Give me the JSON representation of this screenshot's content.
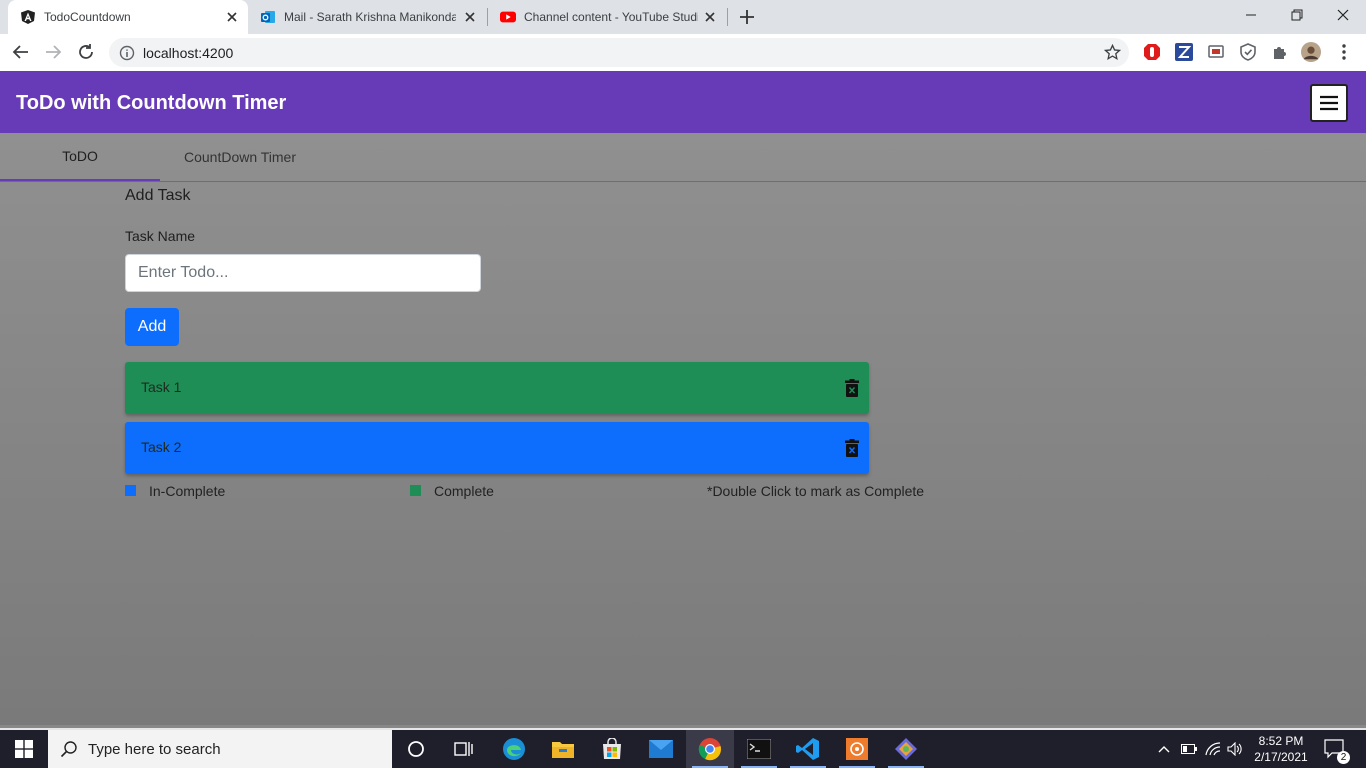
{
  "browser": {
    "tabs": [
      {
        "title": "TodoCountdown",
        "icon": "angular-icon",
        "active": true
      },
      {
        "title": "Mail - Sarath Krishna Manikonda",
        "icon": "outlook-icon",
        "active": false
      },
      {
        "title": "Channel content - YouTube Studio",
        "icon": "youtube-icon",
        "active": false
      }
    ],
    "url": "localhost:4200"
  },
  "app": {
    "title": "ToDo with Countdown Timer",
    "nav_tabs": [
      {
        "label": "ToDO",
        "active": true
      },
      {
        "label": "CountDown Timer",
        "active": false
      }
    ],
    "add_task_heading": "Add Task",
    "task_name_label": "Task Name",
    "todo_placeholder": "Enter Todo...",
    "add_button": "Add",
    "tasks": [
      {
        "name": "Task 1",
        "status": "complete",
        "color": "#1e8e56"
      },
      {
        "name": "Task 2",
        "status": "incomplete",
        "color": "#0d6efd"
      }
    ],
    "legend": {
      "incomplete_label": "In-Complete",
      "incomplete_color": "#0d6efd",
      "complete_label": "Complete",
      "complete_color": "#1e8e56",
      "hint": "*Double Click to mark as Complete"
    }
  },
  "taskbar": {
    "search_placeholder": "Type here to search",
    "time": "8:52 PM",
    "date": "2/17/2021",
    "notification_count": "2"
  }
}
